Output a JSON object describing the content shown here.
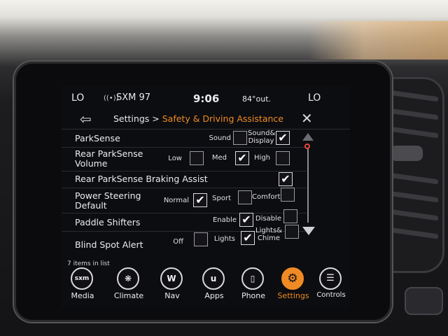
{
  "status_bar": {
    "left_zone": "LO",
    "radio_icon": "radio-signal-icon",
    "station": "SXM 97",
    "time": "9:06",
    "temperature": "84°out.",
    "right_zone": "LO"
  },
  "header": {
    "back_icon": "back-arrow-icon",
    "breadcrumb_root": "Settings",
    "breadcrumb_sep": ">",
    "breadcrumb_current": "Safety & Driving Assistance",
    "close_icon": "close-icon",
    "accent_color": "#f08a24"
  },
  "settings": {
    "parksense": {
      "label": "ParkSense",
      "options": [
        {
          "label": "Sound",
          "checked": false
        },
        {
          "label": "Sound& Display",
          "checked": true
        }
      ]
    },
    "rear_volume": {
      "label": "Rear ParkSense Volume",
      "options": [
        {
          "label": "Low",
          "checked": false
        },
        {
          "label": "Med",
          "checked": true
        },
        {
          "label": "High",
          "checked": false
        }
      ]
    },
    "braking_assist": {
      "label": "Rear ParkSense Braking Assist",
      "checked": true
    },
    "steering": {
      "label": "Power Steering Default",
      "options": [
        {
          "label": "Normal",
          "checked": true
        },
        {
          "label": "Sport",
          "checked": false
        },
        {
          "label": "Comfort",
          "checked": false
        }
      ]
    },
    "paddle": {
      "label": "Paddle Shifters",
      "options": [
        {
          "label": "Enable",
          "checked": true
        },
        {
          "label": "Disable",
          "checked": false
        }
      ]
    },
    "blind_spot": {
      "label": "Blind Spot Alert",
      "options": [
        {
          "label": "Off",
          "checked": false
        },
        {
          "label": "Lights",
          "checked": true
        },
        {
          "label": "Lights& Chime",
          "checked": false
        }
      ]
    }
  },
  "list_count": "7 items in list",
  "dock": [
    {
      "label": "Media",
      "icon": "sxm",
      "active": false
    },
    {
      "label": "Climate",
      "icon": "climate-icon",
      "active": false
    },
    {
      "label": "Nav",
      "icon": "W",
      "active": false
    },
    {
      "label": "Apps",
      "icon": "u",
      "active": false
    },
    {
      "label": "Phone",
      "icon": "phone-icon",
      "active": false
    },
    {
      "label": "Settings",
      "icon": "gear-icon",
      "active": true
    },
    {
      "label": "Controls",
      "icon": "controls-icon",
      "active": false
    }
  ]
}
